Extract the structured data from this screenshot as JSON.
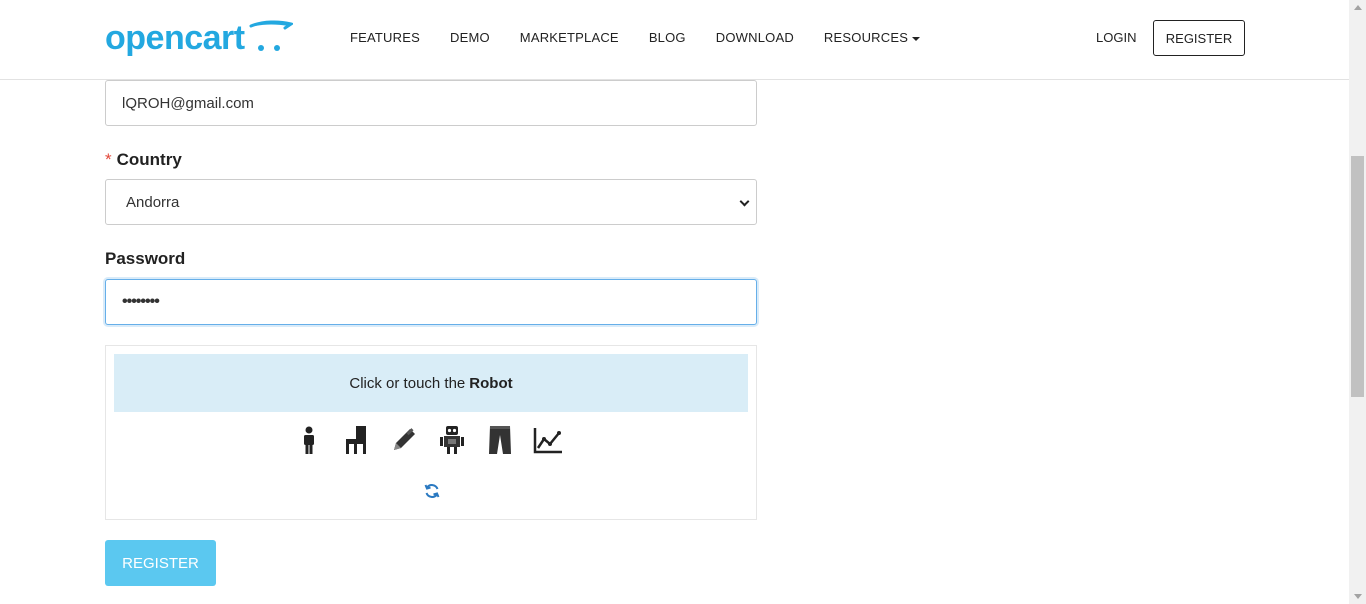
{
  "brand": {
    "name": "opencart",
    "color": "#23a8e0"
  },
  "nav": {
    "items": [
      {
        "label": "FEATURES"
      },
      {
        "label": "DEMO"
      },
      {
        "label": "MARKETPLACE"
      },
      {
        "label": "BLOG"
      },
      {
        "label": "DOWNLOAD"
      },
      {
        "label": "RESOURCES",
        "has_dropdown": true
      }
    ],
    "login": "LOGIN",
    "register": "REGISTER"
  },
  "form": {
    "email": {
      "value": "lQROH@gmail.com"
    },
    "country": {
      "label": "Country",
      "required_marker": "*",
      "selected": "Andorra"
    },
    "password": {
      "label": "Password",
      "masked_value": "••••••••"
    },
    "captcha": {
      "prompt_prefix": "Click or touch the",
      "prompt_target": "Robot",
      "icons": [
        "person-icon",
        "chair-icon",
        "pencil-icon",
        "robot-icon",
        "pants-icon",
        "line-chart-icon"
      ],
      "refresh": "refresh-icon"
    },
    "submit_label": "REGISTER"
  },
  "colors": {
    "accent": "#23a8e0",
    "submit_button": "#5bc8f0",
    "captcha_banner": "#d9edf7",
    "required": "#e2473a",
    "focus_border": "#66afe9"
  }
}
